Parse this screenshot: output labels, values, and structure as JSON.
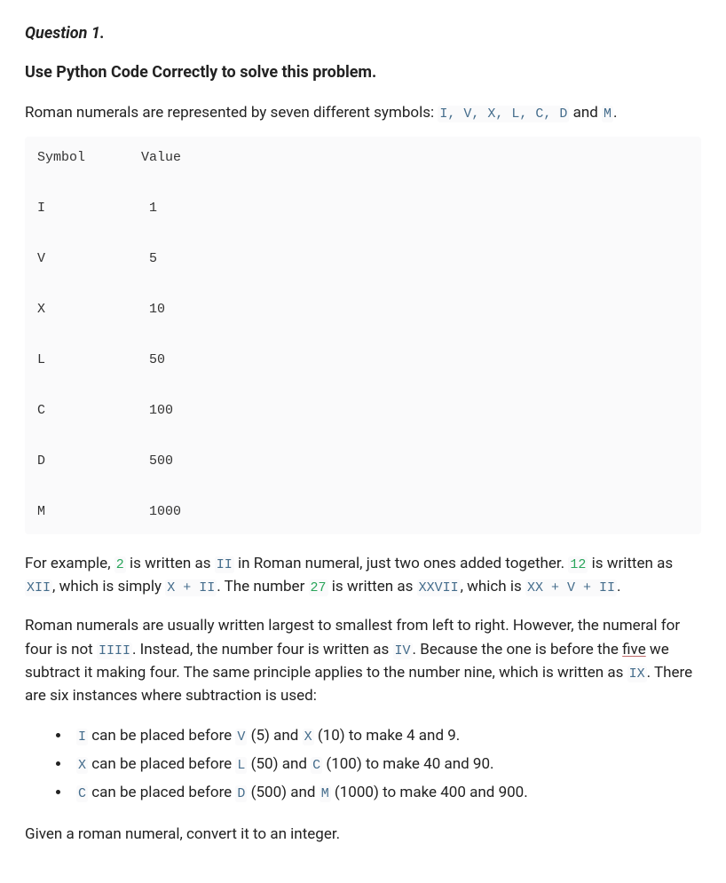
{
  "q_title": "Question 1.",
  "subtitle": "Use Python Code Correctly to solve this problem.",
  "intro_pre": "Roman numerals are represented by seven different symbols: ",
  "intro_syms": "I, V, X, L, C, D",
  "intro_and": " and ",
  "intro_m": "M",
  "intro_dot": ".",
  "table_header_sym": "Symbol",
  "table_header_val": "Value",
  "table": [
    {
      "s": "I",
      "v": "1"
    },
    {
      "s": "V",
      "v": "5"
    },
    {
      "s": "X",
      "v": "10"
    },
    {
      "s": "L",
      "v": "50"
    },
    {
      "s": "C",
      "v": "100"
    },
    {
      "s": "D",
      "v": "500"
    },
    {
      "s": "M",
      "v": "1000"
    }
  ],
  "ex_p1": "For example, ",
  "ex_2": "2",
  "ex_p2": " is written as ",
  "ex_ii": "II",
  "ex_p3": " in Roman numeral, just two ones added together. ",
  "ex_12": "12",
  "ex_p4": " is written as ",
  "ex_xii": "XII",
  "ex_p5": ", which is simply ",
  "ex_x_plus_ii": "X + II",
  "ex_p6": ". The number ",
  "ex_27": "27",
  "ex_p7": " is written as ",
  "ex_xxvii": "XXVII",
  "ex_p8": ", which is ",
  "ex_xx_v_ii": "XX + V + II",
  "ex_p9": ".",
  "sub_p1": "Roman numerals are usually written largest to smallest from left to right. However, the numeral for four is not ",
  "sub_iiii": "IIII",
  "sub_p2": ". Instead, the number four is written as ",
  "sub_iv": "IV",
  "sub_p3": ". Because the one is before the ",
  "sub_five": "five",
  "sub_p4": " we subtract it making four. The same principle applies to the number nine, which is written as ",
  "sub_ix": "IX",
  "sub_p5": ". There are six instances where subtraction is used:",
  "r1_a": "I",
  "r1_t1": " can be placed before ",
  "r1_b": "V",
  "r1_t2": " (5) and ",
  "r1_c": "X",
  "r1_t3": " (10) to make 4 and 9.",
  "r2_a": "X",
  "r2_t1": " can be placed before ",
  "r2_b": "L",
  "r2_t2": " (50) and ",
  "r2_c": "C",
  "r2_t3": " (100) to make 40 and 90.",
  "r3_a": "C",
  "r3_t1": " can be placed before ",
  "r3_b": "D",
  "r3_t2": " (500) and ",
  "r3_c": "M",
  "r3_t3": " (1000) to make 400 and 900.",
  "final": "Given a roman numeral, convert it to an integer."
}
